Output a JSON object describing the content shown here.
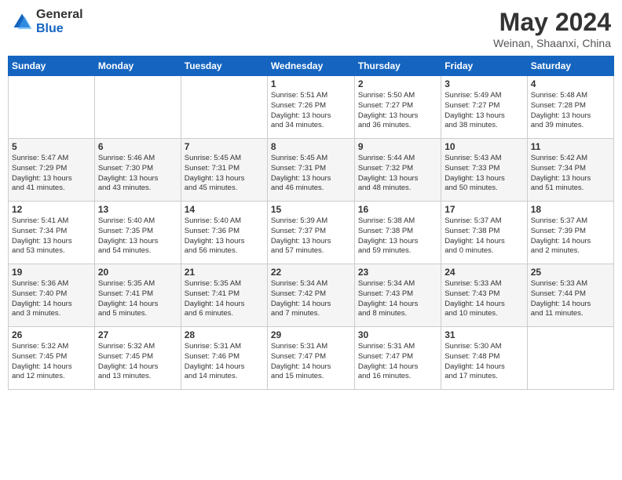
{
  "header": {
    "logo_general": "General",
    "logo_blue": "Blue",
    "month_year": "May 2024",
    "location": "Weinan, Shaanxi, China"
  },
  "days_of_week": [
    "Sunday",
    "Monday",
    "Tuesday",
    "Wednesday",
    "Thursday",
    "Friday",
    "Saturday"
  ],
  "weeks": [
    [
      {
        "day": "",
        "info": ""
      },
      {
        "day": "",
        "info": ""
      },
      {
        "day": "",
        "info": ""
      },
      {
        "day": "1",
        "info": "Sunrise: 5:51 AM\nSunset: 7:26 PM\nDaylight: 13 hours\nand 34 minutes."
      },
      {
        "day": "2",
        "info": "Sunrise: 5:50 AM\nSunset: 7:27 PM\nDaylight: 13 hours\nand 36 minutes."
      },
      {
        "day": "3",
        "info": "Sunrise: 5:49 AM\nSunset: 7:27 PM\nDaylight: 13 hours\nand 38 minutes."
      },
      {
        "day": "4",
        "info": "Sunrise: 5:48 AM\nSunset: 7:28 PM\nDaylight: 13 hours\nand 39 minutes."
      }
    ],
    [
      {
        "day": "5",
        "info": "Sunrise: 5:47 AM\nSunset: 7:29 PM\nDaylight: 13 hours\nand 41 minutes."
      },
      {
        "day": "6",
        "info": "Sunrise: 5:46 AM\nSunset: 7:30 PM\nDaylight: 13 hours\nand 43 minutes."
      },
      {
        "day": "7",
        "info": "Sunrise: 5:45 AM\nSunset: 7:31 PM\nDaylight: 13 hours\nand 45 minutes."
      },
      {
        "day": "8",
        "info": "Sunrise: 5:45 AM\nSunset: 7:31 PM\nDaylight: 13 hours\nand 46 minutes."
      },
      {
        "day": "9",
        "info": "Sunrise: 5:44 AM\nSunset: 7:32 PM\nDaylight: 13 hours\nand 48 minutes."
      },
      {
        "day": "10",
        "info": "Sunrise: 5:43 AM\nSunset: 7:33 PM\nDaylight: 13 hours\nand 50 minutes."
      },
      {
        "day": "11",
        "info": "Sunrise: 5:42 AM\nSunset: 7:34 PM\nDaylight: 13 hours\nand 51 minutes."
      }
    ],
    [
      {
        "day": "12",
        "info": "Sunrise: 5:41 AM\nSunset: 7:34 PM\nDaylight: 13 hours\nand 53 minutes."
      },
      {
        "day": "13",
        "info": "Sunrise: 5:40 AM\nSunset: 7:35 PM\nDaylight: 13 hours\nand 54 minutes."
      },
      {
        "day": "14",
        "info": "Sunrise: 5:40 AM\nSunset: 7:36 PM\nDaylight: 13 hours\nand 56 minutes."
      },
      {
        "day": "15",
        "info": "Sunrise: 5:39 AM\nSunset: 7:37 PM\nDaylight: 13 hours\nand 57 minutes."
      },
      {
        "day": "16",
        "info": "Sunrise: 5:38 AM\nSunset: 7:38 PM\nDaylight: 13 hours\nand 59 minutes."
      },
      {
        "day": "17",
        "info": "Sunrise: 5:37 AM\nSunset: 7:38 PM\nDaylight: 14 hours\nand 0 minutes."
      },
      {
        "day": "18",
        "info": "Sunrise: 5:37 AM\nSunset: 7:39 PM\nDaylight: 14 hours\nand 2 minutes."
      }
    ],
    [
      {
        "day": "19",
        "info": "Sunrise: 5:36 AM\nSunset: 7:40 PM\nDaylight: 14 hours\nand 3 minutes."
      },
      {
        "day": "20",
        "info": "Sunrise: 5:35 AM\nSunset: 7:41 PM\nDaylight: 14 hours\nand 5 minutes."
      },
      {
        "day": "21",
        "info": "Sunrise: 5:35 AM\nSunset: 7:41 PM\nDaylight: 14 hours\nand 6 minutes."
      },
      {
        "day": "22",
        "info": "Sunrise: 5:34 AM\nSunset: 7:42 PM\nDaylight: 14 hours\nand 7 minutes."
      },
      {
        "day": "23",
        "info": "Sunrise: 5:34 AM\nSunset: 7:43 PM\nDaylight: 14 hours\nand 8 minutes."
      },
      {
        "day": "24",
        "info": "Sunrise: 5:33 AM\nSunset: 7:43 PM\nDaylight: 14 hours\nand 10 minutes."
      },
      {
        "day": "25",
        "info": "Sunrise: 5:33 AM\nSunset: 7:44 PM\nDaylight: 14 hours\nand 11 minutes."
      }
    ],
    [
      {
        "day": "26",
        "info": "Sunrise: 5:32 AM\nSunset: 7:45 PM\nDaylight: 14 hours\nand 12 minutes."
      },
      {
        "day": "27",
        "info": "Sunrise: 5:32 AM\nSunset: 7:45 PM\nDaylight: 14 hours\nand 13 minutes."
      },
      {
        "day": "28",
        "info": "Sunrise: 5:31 AM\nSunset: 7:46 PM\nDaylight: 14 hours\nand 14 minutes."
      },
      {
        "day": "29",
        "info": "Sunrise: 5:31 AM\nSunset: 7:47 PM\nDaylight: 14 hours\nand 15 minutes."
      },
      {
        "day": "30",
        "info": "Sunrise: 5:31 AM\nSunset: 7:47 PM\nDaylight: 14 hours\nand 16 minutes."
      },
      {
        "day": "31",
        "info": "Sunrise: 5:30 AM\nSunset: 7:48 PM\nDaylight: 14 hours\nand 17 minutes."
      },
      {
        "day": "",
        "info": ""
      }
    ]
  ]
}
